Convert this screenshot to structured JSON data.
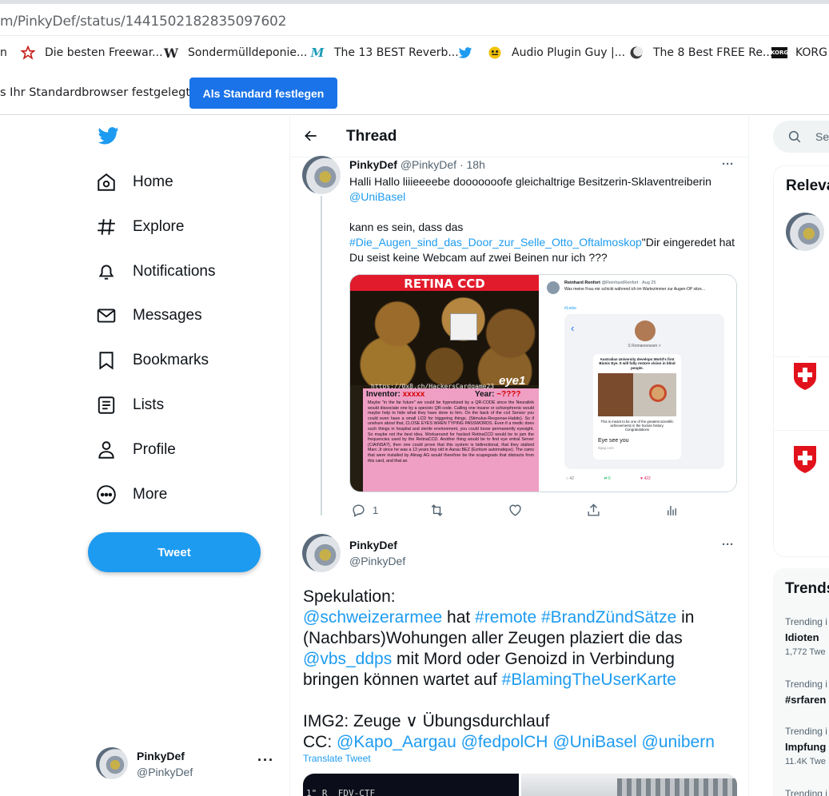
{
  "browser": {
    "url_text": "m/PinkyDef/status/1441502182835097602",
    "bookmarks": [
      {
        "label": "n",
        "icon": ""
      },
      {
        "label": "Die besten Freewar...",
        "icon": "star-icon"
      },
      {
        "label": "Sondermülldeponie...",
        "icon": "wikipedia-icon"
      },
      {
        "label": "The 13 BEST Reverb...",
        "icon": "m-logo-icon"
      },
      {
        "label": "",
        "icon": "twitter-icon"
      },
      {
        "label": "Audio Plugin Guy |...",
        "icon": "plugin-guy-icon"
      },
      {
        "label": "The 8 Best FREE Re...",
        "icon": "moon-icon"
      },
      {
        "label": "KORG",
        "icon": "korg-icon"
      }
    ],
    "infobar_text": "s Ihr Standardbrowser festgelegt",
    "infobar_button": "Als Standard festlegen"
  },
  "nav": {
    "items": [
      {
        "label": "Home",
        "icon": "home-icon"
      },
      {
        "label": "Explore",
        "icon": "hashtag-icon"
      },
      {
        "label": "Notifications",
        "icon": "bell-icon"
      },
      {
        "label": "Messages",
        "icon": "envelope-icon"
      },
      {
        "label": "Bookmarks",
        "icon": "bookmark-icon"
      },
      {
        "label": "Lists",
        "icon": "list-icon"
      },
      {
        "label": "Profile",
        "icon": "person-icon"
      },
      {
        "label": "More",
        "icon": "more-circle-icon"
      }
    ],
    "tweet_button": "Tweet",
    "account": {
      "name": "PinkyDef",
      "handle": "@PinkyDef"
    }
  },
  "thread": {
    "title": "Thread",
    "tweet1": {
      "name": "PinkyDef",
      "handle": "@PinkyDef",
      "time": "18h",
      "line1": "Halli Hallo liiieeeebe dooooooofe gleichaltrige Besitzerin-Sklaventreiberin",
      "mention": "@UniBasel",
      "line2": "kann es sein, dass das",
      "hashtag": "#Die_Augen_sind_das_Door_zur_Selle_Otto_Oftalmoskop",
      "line3": "\"Dir eingeredet hat",
      "line4": "Du seist keine Webcam auf zwei Beinen nur ich ???",
      "reply_count": "1"
    },
    "image_left": {
      "banner": "RETINA CCD",
      "url": "https://0x8.ch/HackersCardgame23",
      "eye_label": "eye1",
      "inventor_label": "Inventor:",
      "inventor_value": "xxxxx",
      "year_label": "Year:",
      "year_value": "~????",
      "body_text": "Maybe \"in the far future\" we could be hypnotized by a QR-CODE since the Neuralink would dissociate one by a specivic QR-code. Calling one insane or schizophrenic would maybe help to hide what they have done to him. On the back of the ccd Sensor you could even have a small LCD for triggering things. (Stimulus-Response-Habits). So if unshure about that, CLOSE EYES WHEN TYPING PASSWORDS. Even if a medic does such things in hospital and sterile environment, you could loose permanently eyesight. So maybe not the best idea. Workaround for hacked RetinaCCD would be to jam the frequencies used by the RetinaCCD. Another thing would be to find eye entral Server (CIA/NSA?), then one could prove that this system is bidirectional, that they stalked Marc Jr since he was a 13 years boy old in Aarau BEZ (Ecriture automatique). The cams that were installed by Alinag AG would therefore be the scapegoats that distracts from this card, and that an"
    },
    "image_right": {
      "author": "Reinhard Renfort",
      "handle": "@ReinhardRenfort · Aug 25",
      "text": "Was meine Frau mir schickt während ich im Wartezimmer zur Augen-OP sitze...",
      "hashtag": "#Liebe",
      "contact": "S Romaneessen >",
      "headline": "Australian University develops World's first Bionic Eye. It will fully restore vision in blind people.",
      "caption": "This is meant to be one of the greatest scientific achievements in the human history. Congratulations",
      "bubble": "Eye see you",
      "source": "9gag.com",
      "stats": [
        "42",
        "6",
        "422"
      ]
    },
    "tweet2": {
      "name": "PinkyDef",
      "handle": "@PinkyDef",
      "intro": "Spekulation:",
      "m1": "@schweizerarmee",
      "t1": " hat ",
      "h1": "#remote",
      "h2": "#BrandZündSätze",
      "t2": " in",
      "t3": "(Nachbars)Wohungen aller Zeugen plaziert die das",
      "m2": "@vbs_ddps",
      "t4": " mit Mord oder Genoizd in Verbindung",
      "t5": "bringen können wartet auf ",
      "h3": "#BlamingTheUserKarte",
      "img2": "IMG2: Zeuge ∨ Übungsdurchlauf",
      "cc": "CC: ",
      "cc1": "@Kapo_Aargau",
      "cc2": "@fedpolCH",
      "cc3": "@UniBasel",
      "cc4": "@unibern",
      "translate": "Translate Tweet",
      "media_text": "1\" R  FDV-CTF"
    }
  },
  "right": {
    "search_placeholder": "Se",
    "relevant_title": "Releva",
    "trends_title": "Trends",
    "trends": [
      {
        "context": "Trending i",
        "name": "Idioten",
        "count": "1,772 Twe"
      },
      {
        "context": "Trending i",
        "name": "#srfaren",
        "count": ""
      },
      {
        "context": "Trending i",
        "name": "Impfung",
        "count": "11.4K Twe"
      },
      {
        "context": "Trending i",
        "name": "",
        "count": ""
      }
    ]
  },
  "colors": {
    "accent": "#1d9bf0",
    "chrome_button": "#1a73e8",
    "text": "#0f1419",
    "muted": "#536471"
  }
}
